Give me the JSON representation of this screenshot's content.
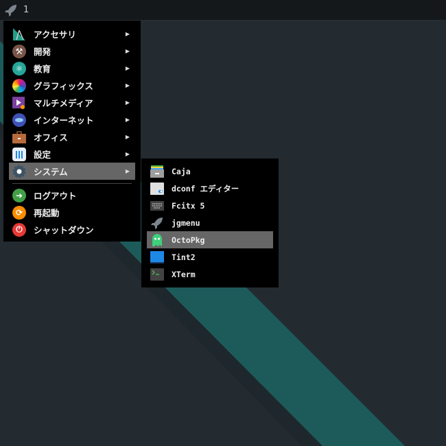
{
  "panel": {
    "workspace": "1"
  },
  "main_menu": {
    "items": [
      {
        "label": "アクセサリ",
        "icon": "accessories-icon",
        "color": "#1fa08a",
        "submenu": true
      },
      {
        "label": "開発",
        "icon": "development-hammer-icon",
        "color": "#795548",
        "submenu": true
      },
      {
        "label": "教育",
        "icon": "education-atom-icon",
        "color": "#26a69a",
        "submenu": true
      },
      {
        "label": "グラフィックス",
        "icon": "graphics-icon",
        "color": "#ff5722",
        "submenu": true
      },
      {
        "label": "マルチメディア",
        "icon": "multimedia-icon",
        "color": "#7b3fa0",
        "submenu": true
      },
      {
        "label": "インターネット",
        "icon": "internet-icon",
        "color": "#3f51b5",
        "submenu": true
      },
      {
        "label": "オフィス",
        "icon": "office-briefcase-icon",
        "color": "#b86a3c",
        "submenu": true
      },
      {
        "label": "設定",
        "icon": "settings-icon",
        "color": "#e8eef5",
        "submenu": true
      },
      {
        "label": "システム",
        "icon": "system-gear-icon",
        "color": "#3d5366",
        "submenu": true,
        "highlighted": true
      }
    ],
    "session": [
      {
        "label": "ログアウト",
        "icon": "logout-icon",
        "color": "#43a047"
      },
      {
        "label": "再起動",
        "icon": "restart-icon",
        "color": "#fb8c00"
      },
      {
        "label": "シャットダウン",
        "icon": "shutdown-icon",
        "color": "#e53935"
      }
    ],
    "arrow": "▶"
  },
  "sub_menu": {
    "items": [
      {
        "label": "Caja",
        "icon": "file-manager-icon"
      },
      {
        "label": "dconf エディター",
        "icon": "dconf-editor-icon"
      },
      {
        "label": "Fcitx 5",
        "icon": "keyboard-icon"
      },
      {
        "label": "jgmenu",
        "icon": "rocket-icon"
      },
      {
        "label": "OctoPkg",
        "icon": "ghost-icon",
        "highlighted": true
      },
      {
        "label": "Tint2",
        "icon": "tint2-icon"
      },
      {
        "label": "XTerm",
        "icon": "terminal-icon"
      }
    ]
  }
}
